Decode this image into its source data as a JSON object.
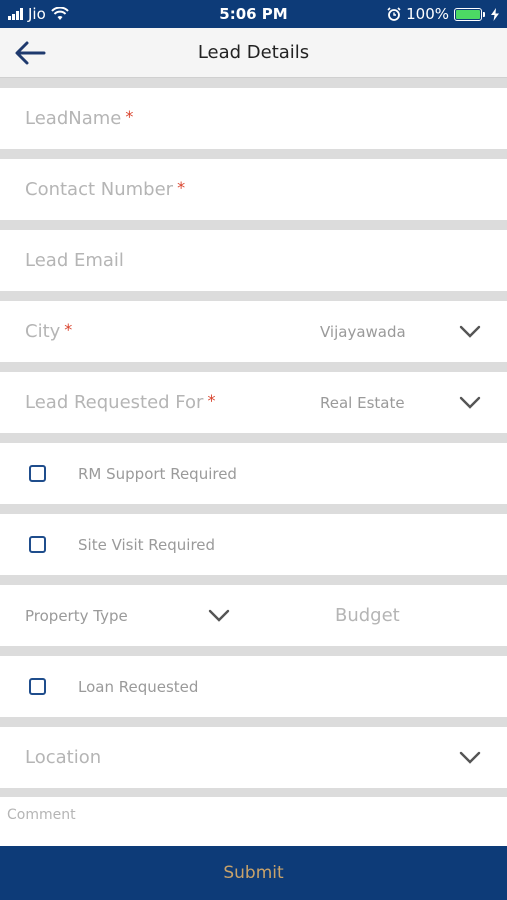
{
  "status_bar": {
    "carrier": "Jio",
    "time": "5:06 PM",
    "battery": "100%",
    "icons": [
      "signal-icon",
      "wifi-icon",
      "alarm-icon",
      "battery-icon",
      "charging-icon"
    ]
  },
  "header": {
    "title": "Lead Details",
    "back_icon": "back-arrow-icon"
  },
  "form": {
    "lead_name": {
      "label": "LeadName",
      "required_mark": "*"
    },
    "contact_number": {
      "label": "Contact Number",
      "required_mark": "*"
    },
    "lead_email": {
      "label": "Lead Email"
    },
    "city": {
      "label": "City",
      "required_mark": "*",
      "value": "Vijayawada"
    },
    "lead_requested_for": {
      "label": "Lead Requested For",
      "required_mark": "*",
      "value": "Real Estate"
    },
    "rm_support": {
      "label": "RM Support Required",
      "checked": false
    },
    "site_visit": {
      "label": "Site Visit Required",
      "checked": false
    },
    "property_type": {
      "label": "Property Type"
    },
    "budget": {
      "label": "Budget"
    },
    "loan_requested": {
      "label": "Loan Requested",
      "checked": false
    },
    "location": {
      "label": "Location"
    },
    "comment": {
      "label": "Comment"
    }
  },
  "submit": {
    "label": "Submit"
  },
  "colors": {
    "primary": "#0d3b78",
    "required": "#d9442e",
    "submit_text": "#c8a26a",
    "checkbox_border": "#1f4d8c"
  }
}
